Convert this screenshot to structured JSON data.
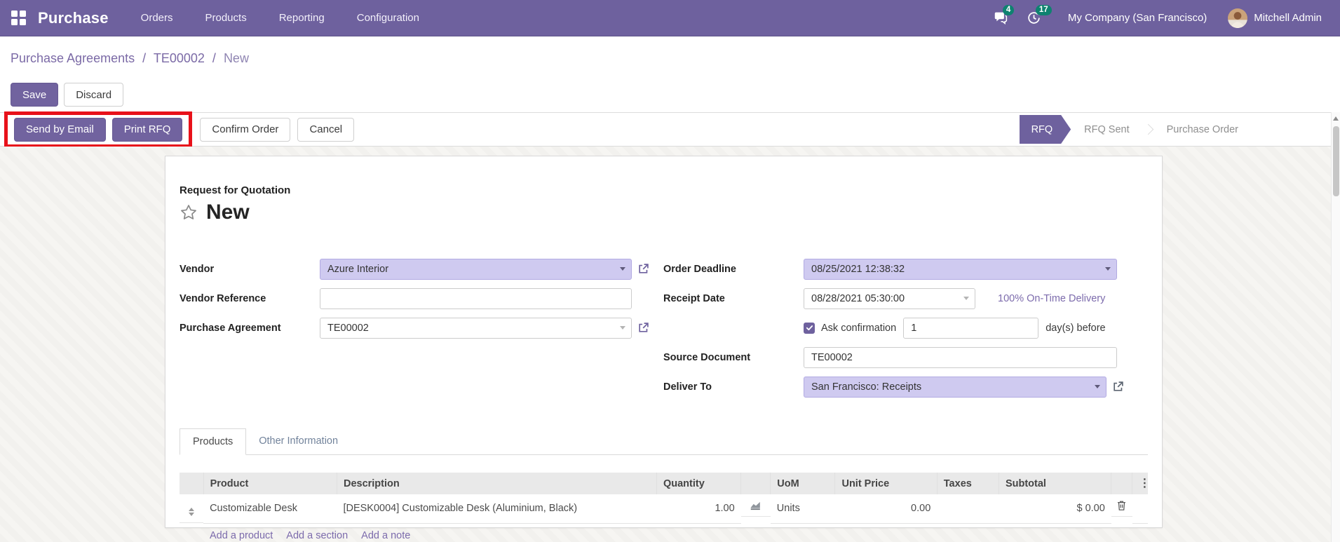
{
  "navbar": {
    "app_name": "Purchase",
    "menu_items": [
      "Orders",
      "Products",
      "Reporting",
      "Configuration"
    ],
    "messages_badge": "4",
    "activities_badge": "17",
    "company_name": "My Company (San Francisco)",
    "user_name": "Mitchell Admin"
  },
  "breadcrumb": {
    "items": [
      "Purchase Agreements",
      "TE00002",
      "New"
    ],
    "separator": "/"
  },
  "toolbar": {
    "save_label": "Save",
    "discard_label": "Discard"
  },
  "actions": {
    "send_by_email": "Send by Email",
    "print_rfq": "Print RFQ",
    "confirm_order": "Confirm Order",
    "cancel": "Cancel"
  },
  "statusbar": {
    "stages": [
      "RFQ",
      "RFQ Sent",
      "Purchase Order"
    ],
    "active_stage": "RFQ"
  },
  "form": {
    "doc_type": "Request for Quotation",
    "title": "New",
    "left_fields": {
      "vendor": {
        "label": "Vendor",
        "value": "Azure Interior"
      },
      "vendor_reference": {
        "label": "Vendor Reference",
        "value": ""
      },
      "purchase_agreement": {
        "label": "Purchase Agreement",
        "value": "TE00002"
      }
    },
    "right_fields": {
      "order_deadline": {
        "label": "Order Deadline",
        "value": "08/25/2021 12:38:32"
      },
      "receipt_date": {
        "label": "Receipt Date",
        "value": "08/28/2021 05:30:00",
        "on_time": "100% On-Time Delivery"
      },
      "ask_confirmation": {
        "label": "Ask confirmation",
        "value": "1",
        "suffix": "day(s) before",
        "checked": true
      },
      "source_document": {
        "label": "Source Document",
        "value": "TE00002"
      },
      "deliver_to": {
        "label": "Deliver To",
        "value": "San Francisco: Receipts"
      }
    }
  },
  "tabs": {
    "items": [
      "Products",
      "Other Information"
    ],
    "active": "Products"
  },
  "products_table": {
    "columns": [
      "Product",
      "Description",
      "Quantity",
      "UoM",
      "Unit Price",
      "Taxes",
      "Subtotal"
    ],
    "rows": [
      {
        "product": "Customizable Desk",
        "description": "[DESK0004] Customizable Desk (Aluminium, Black)",
        "quantity": "1.00",
        "uom": "Units",
        "unit_price": "0.00",
        "taxes": "",
        "subtotal": "$ 0.00"
      }
    ],
    "links": [
      "Add a product",
      "Add a section",
      "Add a note"
    ]
  },
  "icons": {
    "column_options": "⋮"
  },
  "colors": {
    "navbar_bg": "#6e619e",
    "accent": "#6e619e",
    "badge": "#0e8270",
    "field_highlight": "#cfcaf0",
    "link": "#7c6bac",
    "highlight_box": "#e8111a"
  }
}
